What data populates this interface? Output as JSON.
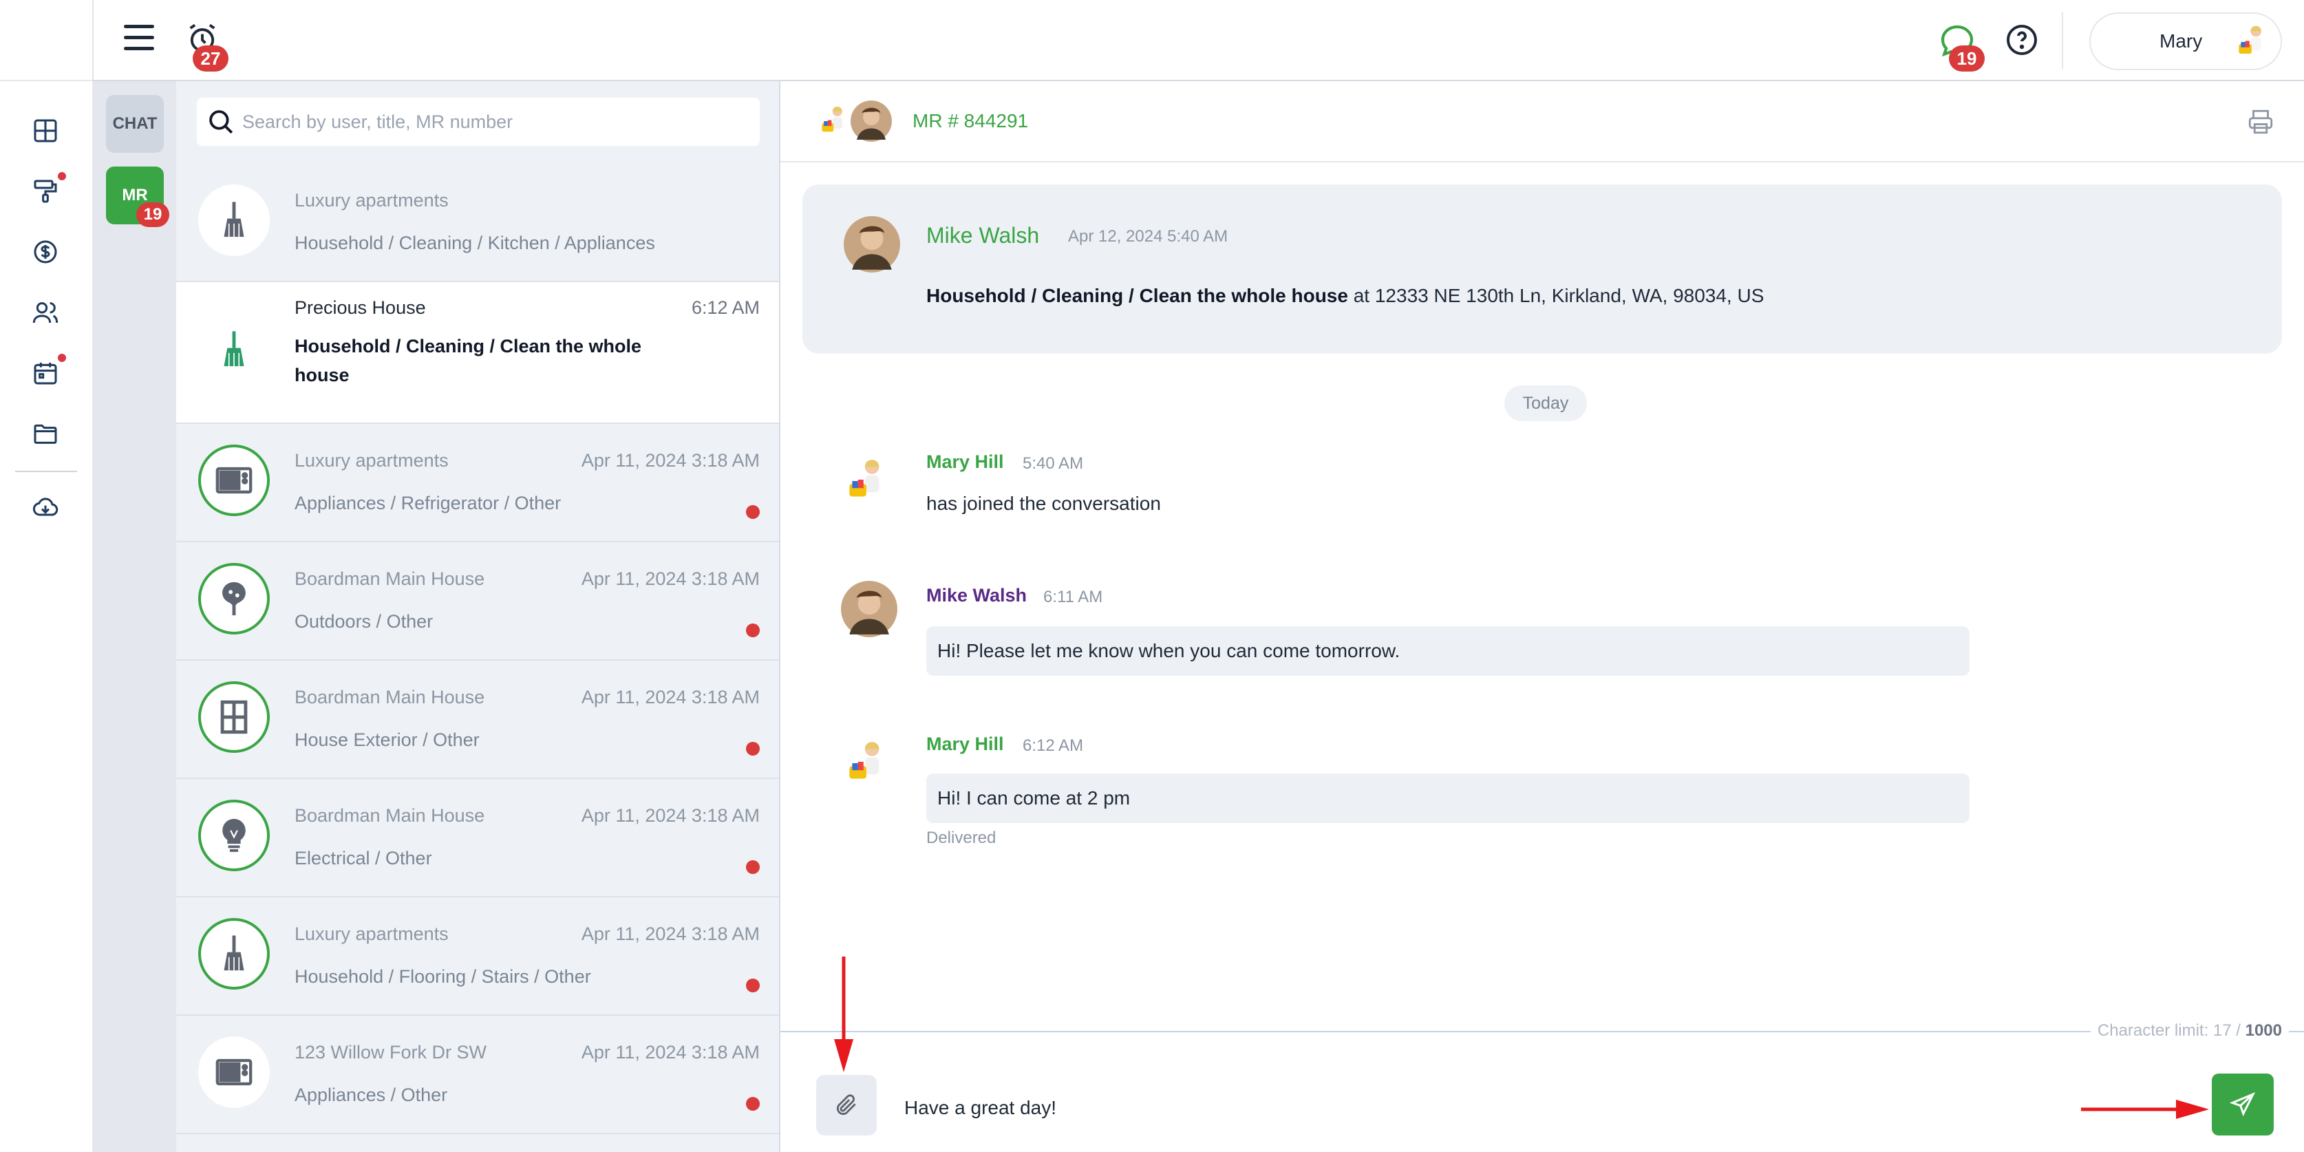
{
  "topbar": {
    "alarm_count": "27",
    "chat_count": "19",
    "user_name": "Mary"
  },
  "rail": {
    "items": [
      "dashboard-icon",
      "paint-roller-icon",
      "dollar-icon",
      "users-icon",
      "calendar-icon",
      "folder-icon",
      "cloud-download-icon"
    ]
  },
  "tabs": {
    "chat_label": "CHAT",
    "mr_label": "MR",
    "mr_count": "19"
  },
  "search": {
    "placeholder": "Search by user, title, MR number"
  },
  "list": [
    {
      "title": "Luxury apartments",
      "subtitle": "Household / Cleaning / Kitchen / Appliances",
      "time": "",
      "icon": "broom-icon",
      "unread": false
    },
    {
      "title": "Precious House",
      "subtitle": "Household / Cleaning / Clean the whole house",
      "time": "6:12 AM",
      "icon": "broom-icon",
      "unread": false
    },
    {
      "title": "Luxury apartments",
      "subtitle": "Appliances / Refrigerator / Other",
      "time": "Apr 11, 2024 3:18 AM",
      "icon": "microwave-icon",
      "unread": true
    },
    {
      "title": "Boardman Main House",
      "subtitle": "Outdoors / Other",
      "time": "Apr 11, 2024 3:18 AM",
      "icon": "tree-icon",
      "unread": true
    },
    {
      "title": "Boardman Main House",
      "subtitle": "House Exterior / Other",
      "time": "Apr 11, 2024 3:18 AM",
      "icon": "window-icon",
      "unread": true
    },
    {
      "title": "Boardman Main House",
      "subtitle": "Electrical / Other",
      "time": "Apr 11, 2024 3:18 AM",
      "icon": "lightbulb-icon",
      "unread": true
    },
    {
      "title": "Luxury apartments",
      "subtitle": "Household / Flooring / Stairs / Other",
      "time": "Apr 11, 2024 3:18 AM",
      "icon": "broom-icon",
      "unread": true
    },
    {
      "title": "123 Willow Fork Dr SW",
      "subtitle": "Appliances / Other",
      "time": "Apr 11, 2024 3:18 AM",
      "icon": "microwave-icon",
      "unread": true
    }
  ],
  "chat": {
    "mr_number": "MR # 844291",
    "task": {
      "author": "Mike Walsh",
      "time": "Apr 12, 2024 5:40 AM",
      "category": "Household / Cleaning / Clean the whole house",
      "address": " at 12333 NE 130th Ln, Kirkland, WA, 98034, US"
    },
    "day_label": "Today",
    "messages": [
      {
        "author": "Mary Hill",
        "time": "5:40 AM",
        "text": "has joined the conversation",
        "color": "#3aa544"
      },
      {
        "author": "Mike Walsh",
        "time": "6:11 AM",
        "text": "Hi! Please let me know when you can come tomorrow.",
        "color": "#5b2a86"
      },
      {
        "author": "Mary Hill",
        "time": "6:12 AM",
        "text": "Hi! I can come at 2 pm",
        "color": "#3aa544",
        "status": "Delivered"
      }
    ],
    "char_limit_label": "Character limit: 17 / ",
    "char_limit_max": "1000",
    "input_value": "Have a great day!"
  },
  "colors": {
    "accent": "#3aa544",
    "badge": "#d93a3a",
    "annotation_arrow": "#e8191c"
  }
}
